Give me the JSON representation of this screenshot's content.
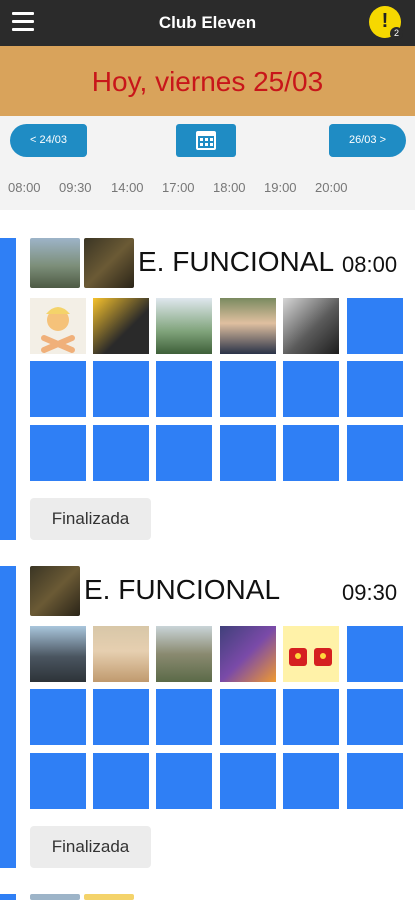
{
  "header": {
    "title": "Club Eleven",
    "alert_count": "2",
    "alert_symbol": "!"
  },
  "date_banner": {
    "text": "Hoy, viernes 25/03"
  },
  "nav": {
    "prev_label": "< 24/03",
    "next_label": "26/03 >",
    "calendar_icon": "calendar-icon"
  },
  "times": [
    "08:00",
    "09:30",
    "14:00",
    "17:00",
    "18:00",
    "19:00",
    "20:00"
  ],
  "classes": [
    {
      "title": "E. FUNCIONAL",
      "time": "08:00",
      "status": "Finalizada",
      "booked": 5,
      "slots": 18,
      "title_avatars": 2
    },
    {
      "title": "E. FUNCIONAL",
      "time": "09:30",
      "status": "Finalizada",
      "booked": 5,
      "slots": 18,
      "title_avatars": 1
    }
  ],
  "colors": {
    "accent": "#2f7ff5",
    "topbar": "#2b2b2b",
    "banner": "#d9a35b",
    "date_text": "#c8161a",
    "pill": "#1f8cc4"
  }
}
